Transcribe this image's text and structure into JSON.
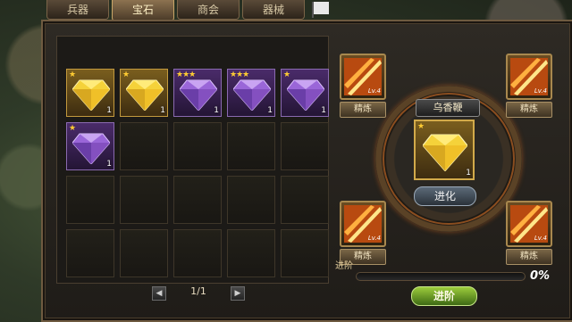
{
  "tabs": [
    "兵器",
    "宝石",
    "商会",
    "器械"
  ],
  "active_tab": "宝石",
  "inventory": [
    {
      "type": "gold",
      "stars": "★",
      "qty": "1"
    },
    {
      "type": "gold",
      "stars": "★",
      "qty": "1"
    },
    {
      "type": "purple",
      "stars": "★★★",
      "qty": "1"
    },
    {
      "type": "purple",
      "stars": "★★★",
      "qty": "1"
    },
    {
      "type": "purple",
      "stars": "★",
      "qty": "1"
    },
    {
      "type": "purple",
      "stars": "★",
      "qty": "1"
    }
  ],
  "pager": {
    "text": "1/1",
    "prev_icon": "arrow-left-icon",
    "next_icon": "arrow-right-icon"
  },
  "weapon_slots": [
    {
      "level": "Lv.4",
      "label": "精炼"
    },
    {
      "level": "Lv.4",
      "label": "精炼"
    },
    {
      "level": "Lv.4",
      "label": "精炼"
    },
    {
      "level": "Lv.4",
      "label": "精炼"
    }
  ],
  "center": {
    "name": "乌香鞭",
    "stars": "★",
    "qty": "1",
    "evolve_label": "进化"
  },
  "progress": {
    "label": "进阶",
    "value": 0,
    "percent_text": "0%"
  },
  "advance_button": "进阶",
  "colors": {
    "gold": "#c39a3e",
    "purple": "#8a6ab0",
    "accent": "#ffcc33",
    "advance_green": "#7ab82c"
  }
}
